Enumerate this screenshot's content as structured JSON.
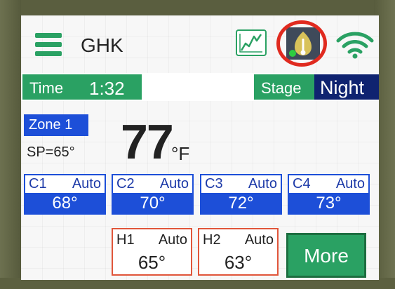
{
  "header": {
    "title": "GHK",
    "icons": {
      "menu": "hamburger-menu-icon",
      "chart": "line-chart-icon",
      "weather": "weather-station-icon",
      "wifi": "wifi-icon"
    }
  },
  "status": {
    "time_label": "Time",
    "time_value": "1:32",
    "stage_label": "Stage",
    "stage_value": "Night"
  },
  "zone": {
    "name": "Zone 1",
    "setpoint": "SP=65°",
    "temperature": "77",
    "unit": "°F"
  },
  "cooling": [
    {
      "name": "C1",
      "mode": "Auto",
      "value": "68°"
    },
    {
      "name": "C2",
      "mode": "Auto",
      "value": "70°"
    },
    {
      "name": "C3",
      "mode": "Auto",
      "value": "72°"
    },
    {
      "name": "C4",
      "mode": "Auto",
      "value": "73°"
    }
  ],
  "heating": [
    {
      "name": "H1",
      "mode": "Auto",
      "value": "65°"
    },
    {
      "name": "H2",
      "mode": "Auto",
      "value": "63°"
    }
  ],
  "more_label": "More",
  "colors": {
    "green": "#2aa163",
    "blue": "#1d4fd8",
    "navy": "#0f2370",
    "heat_border": "#e0553a",
    "highlight": "#e02a1f"
  }
}
